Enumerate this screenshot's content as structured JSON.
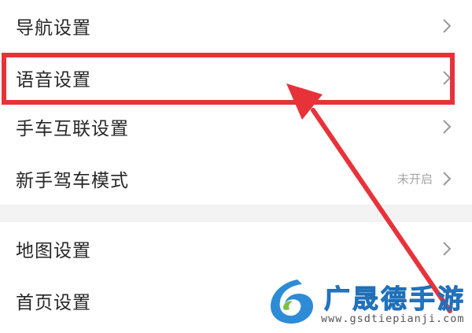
{
  "settings_list": {
    "group1": [
      {
        "label": "导航设置"
      },
      {
        "label": "语音设置"
      },
      {
        "label": "手车互联设置"
      },
      {
        "label": "新手驾车模式",
        "status": "未开启"
      }
    ],
    "group2": [
      {
        "label": "地图设置"
      },
      {
        "label": "首页设置"
      }
    ]
  },
  "annotation": {
    "highlight_color": "#e8323a",
    "target": "语音设置"
  },
  "watermark": {
    "title": "广晟德手游",
    "url": "www.gsdtiepianji.com",
    "brand_color": "#2e8bd6"
  },
  "icons": {
    "row_chevron": "chevron-right-icon",
    "watermark_logo": "brand-logo-icon",
    "annotation": "red-arrow-icon"
  }
}
